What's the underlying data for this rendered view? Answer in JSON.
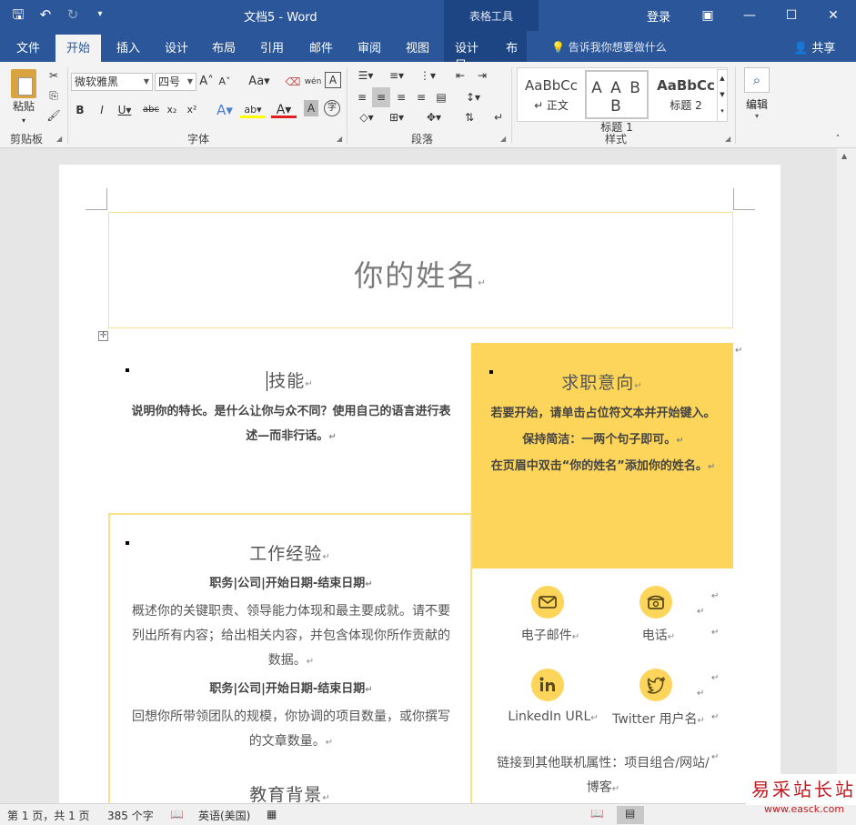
{
  "titlebar": {
    "doc_title": "文档5  -  Word",
    "context_tool": "表格工具",
    "login": "登录"
  },
  "tabs": {
    "file": "文件",
    "home": "开始",
    "insert": "插入",
    "design": "设计",
    "layout": "布局",
    "references": "引用",
    "mailings": "邮件",
    "review": "审阅",
    "view": "视图",
    "table_design": "设计",
    "table_layout": "布局",
    "tell_me": "告诉我你想要做什么",
    "share": "共享"
  },
  "ribbon": {
    "paste": "粘贴",
    "clipboard": "剪贴板",
    "font_name": "微软雅黑",
    "font_size": "四号",
    "font_group": "字体",
    "paragraph_group": "段落",
    "styles_group": "样式",
    "edit": "编辑",
    "styles": [
      {
        "sample": "AaBbCc",
        "name": "↵ 正文"
      },
      {
        "sample": "A A B B",
        "name": "标题 1"
      },
      {
        "sample": "AaBbCc",
        "name": "标题 2"
      }
    ]
  },
  "document": {
    "name": "你的姓名",
    "skills_title": "技能",
    "skills_body": "说明你的特长。是什么让你与众不同？使用自己的语言进行表述—而非行话。",
    "objective_title": "求职意向",
    "objective_line1": "若要开始，请单击占位符文本并开始键入。保持简洁：一两个句子即可。",
    "objective_line2": "在页眉中双击“你的姓名”添加你的姓名。",
    "work_title": "工作经验",
    "job1_header": "职务|公司|开始日期-结束日期",
    "job1_body": "概述你的关键职责、领导能力体现和最主要成就。请不要列出所有内容；给出相关内容，并包含体现你所作贡献的数据。",
    "job2_header": "职务|公司|开始日期-结束日期",
    "job2_body": "回想你所带领团队的规模，你协调的项目数量，或你撰写的文章数量。",
    "education_title": "教育背景",
    "email": "电子邮件",
    "phone": "电话",
    "linkedin": "LinkedIn URL",
    "twitter": "Twitter 用户名",
    "other_link": "链接到其他联机属性：项目组合/网站/博客"
  },
  "statusbar": {
    "page": "第 1 页，共 1 页",
    "words": "385 个字",
    "language": "英语(美国)"
  },
  "watermark": {
    "cn": "易采站长站",
    "url": "www.easck.com"
  },
  "colors": {
    "word_blue": "#2b579a",
    "accent_yellow": "#fdd55a",
    "border_yellow": "#f9e08a"
  }
}
